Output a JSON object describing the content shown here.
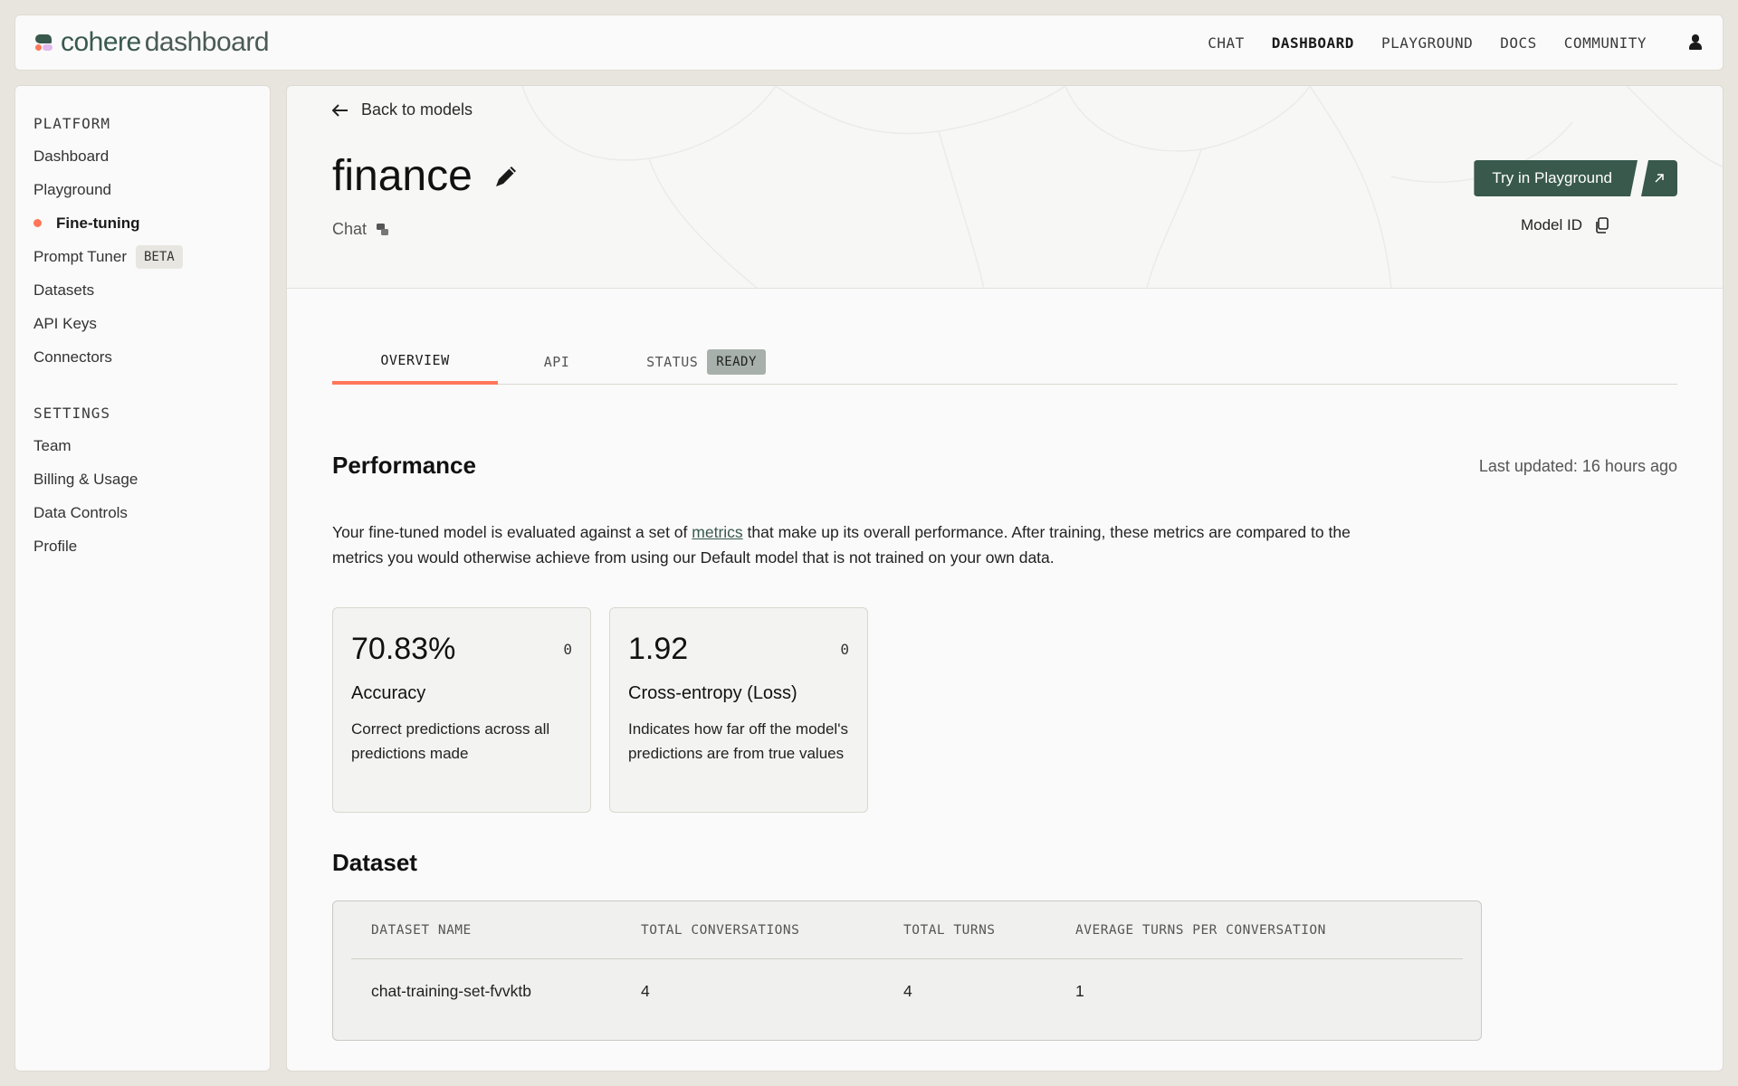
{
  "app": {
    "brand": "cohere",
    "product": "dashboard"
  },
  "topnav": {
    "items": [
      "CHAT",
      "DASHBOARD",
      "PLAYGROUND",
      "DOCS",
      "COMMUNITY"
    ],
    "active": "DASHBOARD"
  },
  "sidebar": {
    "platform": {
      "heading": "PLATFORM",
      "items": [
        "Dashboard",
        "Playground",
        "Fine-tuning",
        "Prompt Tuner",
        "Datasets",
        "API Keys",
        "Connectors"
      ],
      "active": "Fine-tuning",
      "badge": "BETA"
    },
    "settings": {
      "heading": "SETTINGS",
      "items": [
        "Team",
        "Billing & Usage",
        "Data Controls",
        "Profile"
      ]
    }
  },
  "model": {
    "back_label": "Back to models",
    "name": "finance",
    "type": "Chat",
    "try_label": "Try in Playground",
    "model_id_label": "Model ID"
  },
  "tabs": {
    "overview": "OVERVIEW",
    "api": "API",
    "status": "STATUS",
    "status_badge": "READY"
  },
  "performance": {
    "heading": "Performance",
    "updated": "Last updated: 16 hours ago",
    "desc_before": "Your fine-tuned model is evaluated against a set of ",
    "desc_link": "metrics",
    "desc_after": " that make up its overall performance. After training, these metrics are compared to the metrics you would otherwise achieve from using our Default model that is not trained on your own data.",
    "cards": [
      {
        "value": "70.83%",
        "count": "0",
        "name": "Accuracy",
        "note": "Correct predictions across all predictions made"
      },
      {
        "value": "1.92",
        "count": "0",
        "name": "Cross-entropy (Loss)",
        "note": "Indicates how far off the model's predictions are from true values"
      }
    ]
  },
  "dataset": {
    "heading": "Dataset",
    "columns": [
      "DATASET NAME",
      "TOTAL CONVERSATIONS",
      "TOTAL TURNS",
      "AVERAGE TURNS PER CONVERSATION"
    ],
    "rows": [
      [
        "chat-training-set-fvvktb",
        "4",
        "4",
        "1"
      ]
    ]
  },
  "colors": {
    "accent": "#ff7759",
    "brand_green": "#39594d",
    "ready_badge": "#a7b0aa"
  },
  "icons": {
    "back": "arrow-left-icon",
    "edit": "pencil-icon",
    "chat": "chat-bubble-icon",
    "external": "arrow-up-right-icon",
    "copy": "copy-icon",
    "user": "user-icon"
  }
}
